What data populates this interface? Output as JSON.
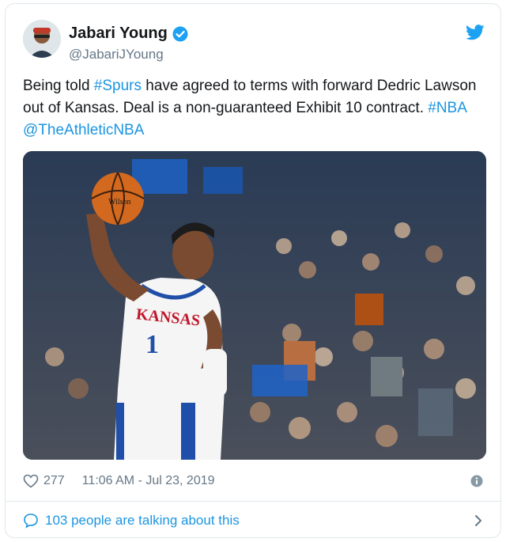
{
  "author": {
    "name": "Jabari Young",
    "handle": "@JabariJYoung",
    "verified_icon": "verified-badge-icon"
  },
  "tweet": {
    "text_parts": [
      {
        "text": "Being told ",
        "link": false
      },
      {
        "text": "#Spurs",
        "link": true
      },
      {
        "text": " have agreed to terms with forward Dedric Lawson out of Kansas. Deal is a non-guaranteed Exhibit 10 contract. ",
        "link": false
      },
      {
        "text": "#NBA",
        "link": true
      },
      {
        "text": " ",
        "link": false
      },
      {
        "text": "@TheAthleticNBA",
        "link": true
      }
    ],
    "media": {
      "jersey_text": "KANSAS",
      "jersey_number": "1",
      "ball_text": "Wilson"
    }
  },
  "meta": {
    "likes": "277",
    "timestamp": "11:06 AM - Jul 23, 2019"
  },
  "footer": {
    "talking": "103 people are talking about this"
  },
  "colors": {
    "link": "#1b95e0",
    "text": "#14171a",
    "muted": "#657786",
    "border": "#e1e8ed"
  }
}
